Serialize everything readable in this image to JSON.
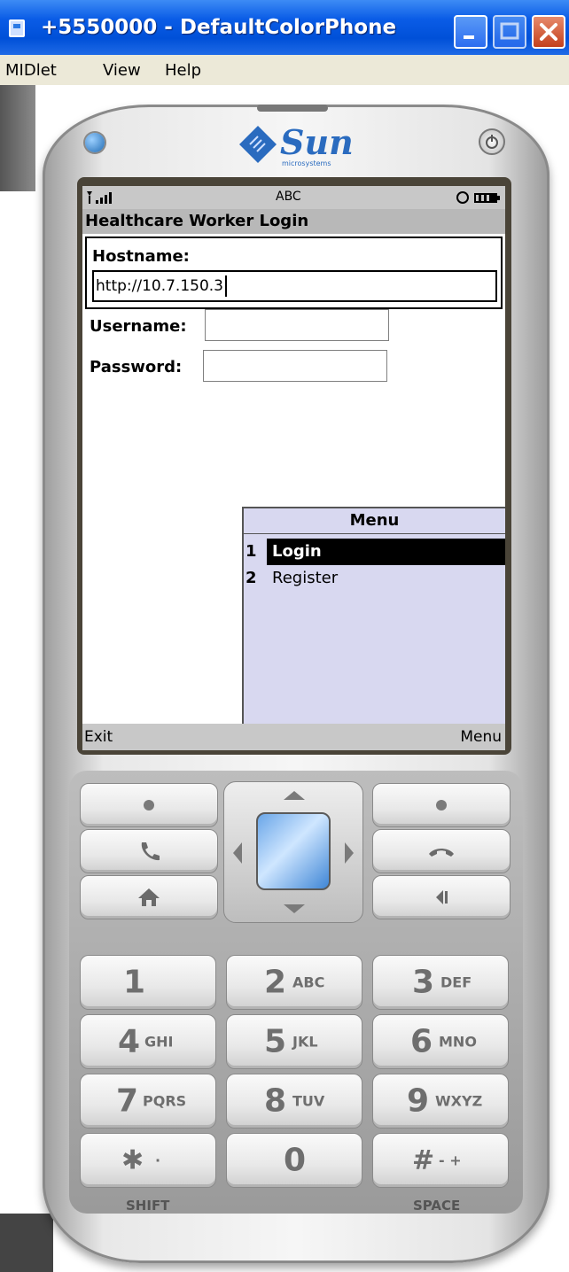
{
  "window": {
    "title": "+5550000 - DefaultColorPhone",
    "menu": [
      "MIDlet",
      "View",
      "Help"
    ]
  },
  "phone": {
    "brand": "Sun",
    "brand_sub": "microsystems",
    "status_mode": "ABC",
    "screen_title": "Healthcare Worker Login",
    "hostname_label": "Hostname:",
    "hostname_value": "http://10.7.150.3",
    "username_label": "Username:",
    "username_value": "",
    "password_label": "Password:",
    "password_value": "",
    "menu_title": "Menu",
    "menu_items": [
      {
        "num": "1",
        "label": "Login",
        "selected": true
      },
      {
        "num": "2",
        "label": "Register",
        "selected": false
      }
    ],
    "soft_left": "Exit",
    "soft_right": "Menu",
    "keys": [
      {
        "digit": "1",
        "letters": ""
      },
      {
        "digit": "2",
        "letters": "ABC"
      },
      {
        "digit": "3",
        "letters": "DEF"
      },
      {
        "digit": "4",
        "letters": "GHI"
      },
      {
        "digit": "5",
        "letters": "JKL"
      },
      {
        "digit": "6",
        "letters": "MNO"
      },
      {
        "digit": "7",
        "letters": "PQRS"
      },
      {
        "digit": "8",
        "letters": "TUV"
      },
      {
        "digit": "9",
        "letters": "WXYZ"
      },
      {
        "digit": "✱",
        "letters": "·"
      },
      {
        "digit": "0",
        "letters": ""
      },
      {
        "digit": "#",
        "letters": "- +"
      }
    ],
    "shift_label": "SHIFT",
    "space_label": "SPACE"
  },
  "icons": {
    "window_close": "close-icon",
    "window_min": "minimize-icon",
    "window_max": "maximize-icon",
    "call": "phone-call-icon",
    "hangup": "phone-hangup-icon",
    "home": "home-icon",
    "back": "back-icon",
    "power": "power-icon"
  }
}
